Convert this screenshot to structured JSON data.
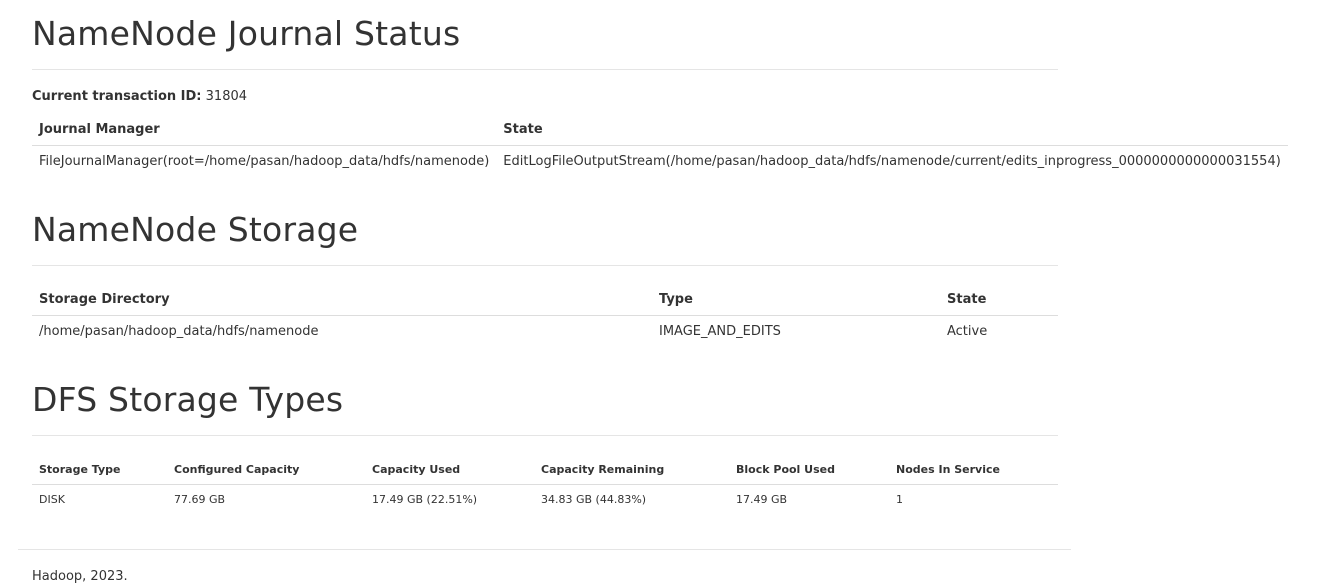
{
  "journal": {
    "title": "NameNode Journal Status",
    "txid_label": "Current transaction ID:",
    "txid_value": "31804",
    "columns": [
      "Journal Manager",
      "State"
    ],
    "rows": [
      {
        "manager": "FileJournalManager(root=/home/pasan/hadoop_data/hdfs/namenode)",
        "state": "EditLogFileOutputStream(/home/pasan/hadoop_data/hdfs/namenode/current/edits_inprogress_0000000000000031554)"
      }
    ]
  },
  "storage": {
    "title": "NameNode Storage",
    "columns": [
      "Storage Directory",
      "Type",
      "State"
    ],
    "rows": [
      {
        "directory": "/home/pasan/hadoop_data/hdfs/namenode",
        "type": "IMAGE_AND_EDITS",
        "state": "Active"
      }
    ]
  },
  "dfs_types": {
    "title": "DFS Storage Types",
    "columns": [
      "Storage Type",
      "Configured Capacity",
      "Capacity Used",
      "Capacity Remaining",
      "Block Pool Used",
      "Nodes In Service"
    ],
    "rows": [
      {
        "storage_type": "DISK",
        "configured_capacity": "77.69 GB",
        "capacity_used": "17.49 GB (22.51%)",
        "capacity_remaining": "34.83 GB (44.83%)",
        "block_pool_used": "17.49 GB",
        "nodes_in_service": "1"
      }
    ]
  },
  "footer": {
    "text": "Hadoop, 2023."
  }
}
